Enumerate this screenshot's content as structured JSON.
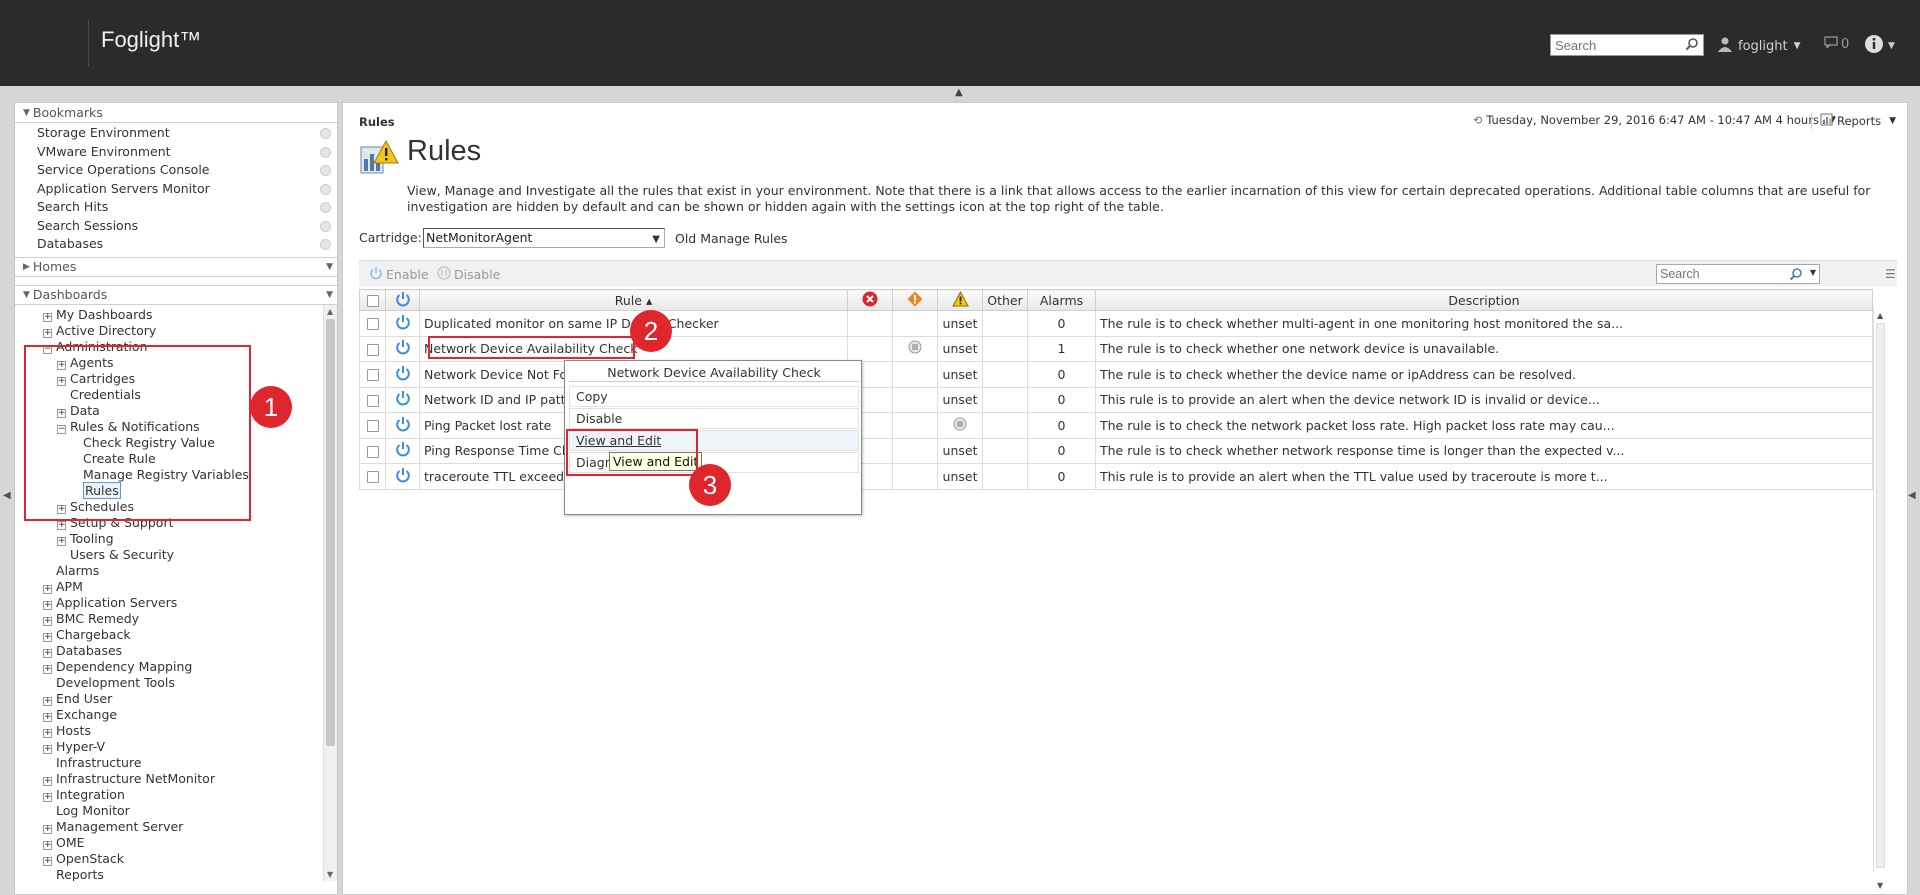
{
  "header": {
    "brand": "Foglight™",
    "search_placeholder": "Search",
    "user": "foglight",
    "messages_count": "0"
  },
  "bookmarks": {
    "title": "Bookmarks",
    "items": [
      "Storage Environment",
      "VMware Environment",
      "Service Operations Console",
      "Application Servers Monitor",
      "Search Hits",
      "Search Sessions",
      "Databases"
    ]
  },
  "homes": {
    "title": "Homes"
  },
  "dashboards": {
    "title": "Dashboards",
    "tree": [
      {
        "label": "My Dashboards",
        "pm": "+",
        "level": 0
      },
      {
        "label": "Active Directory",
        "pm": "+",
        "level": 0
      },
      {
        "label": "Administration",
        "pm": "−",
        "level": 0
      },
      {
        "label": "Agents",
        "pm": "+",
        "level": 1
      },
      {
        "label": "Cartridges",
        "pm": "+",
        "level": 1
      },
      {
        "label": "Credentials",
        "pm": "",
        "level": 1
      },
      {
        "label": "Data",
        "pm": "+",
        "level": 1
      },
      {
        "label": "Rules & Notifications",
        "pm": "−",
        "level": 1
      },
      {
        "label": "Check Registry Value",
        "pm": "",
        "level": 2
      },
      {
        "label": "Create Rule",
        "pm": "",
        "level": 2
      },
      {
        "label": "Manage Registry Variables",
        "pm": "",
        "level": 2
      },
      {
        "label": "Rules",
        "pm": "",
        "level": 2,
        "selected": true
      },
      {
        "label": "Schedules",
        "pm": "+",
        "level": 1
      },
      {
        "label": "Setup & Support",
        "pm": "+",
        "level": 1
      },
      {
        "label": "Tooling",
        "pm": "+",
        "level": 1
      },
      {
        "label": "Users & Security",
        "pm": "",
        "level": 1
      },
      {
        "label": "Alarms",
        "pm": "",
        "level": 0
      },
      {
        "label": "APM",
        "pm": "+",
        "level": 0
      },
      {
        "label": "Application Servers",
        "pm": "+",
        "level": 0
      },
      {
        "label": "BMC Remedy",
        "pm": "+",
        "level": 0
      },
      {
        "label": "Chargeback",
        "pm": "+",
        "level": 0
      },
      {
        "label": "Databases",
        "pm": "+",
        "level": 0
      },
      {
        "label": "Dependency Mapping",
        "pm": "+",
        "level": 0
      },
      {
        "label": "Development Tools",
        "pm": "",
        "level": 0
      },
      {
        "label": "End User",
        "pm": "+",
        "level": 0
      },
      {
        "label": "Exchange",
        "pm": "+",
        "level": 0
      },
      {
        "label": "Hosts",
        "pm": "+",
        "level": 0
      },
      {
        "label": "Hyper-V",
        "pm": "+",
        "level": 0
      },
      {
        "label": "Infrastructure",
        "pm": "",
        "level": 0
      },
      {
        "label": "Infrastructure NetMonitor",
        "pm": "+",
        "level": 0
      },
      {
        "label": "Integration",
        "pm": "+",
        "level": 0
      },
      {
        "label": "Log Monitor",
        "pm": "",
        "level": 0
      },
      {
        "label": "Management Server",
        "pm": "+",
        "level": 0
      },
      {
        "label": "OME",
        "pm": "+",
        "level": 0
      },
      {
        "label": "OpenStack",
        "pm": "+",
        "level": 0
      },
      {
        "label": "Reports",
        "pm": "",
        "level": 0
      }
    ]
  },
  "main": {
    "breadcrumb": "Rules",
    "time_range": "Tuesday, November 29, 2016 6:47 AM - 10:47 AM 4 hours",
    "reports_label": "Reports",
    "title": "Rules",
    "description": "View, Manage and Investigate all the rules that exist in your environment. Note that there is a link that allows access to the earlier incarnation of this view for certain deprecated operations. Additional table columns that are useful for investigation are hidden by default and can be shown or hidden again with the settings icon at the top right of the table.",
    "cartridge_label": "Cartridge:",
    "cartridge_value": "NetMonitorAgent",
    "old_manage_link": "Old Manage Rules",
    "toolbar": {
      "enable": "Enable",
      "disable": "Disable",
      "search_placeholder": "Search"
    },
    "columns": {
      "rule": "Rule ▴",
      "other": "Other",
      "alarms": "Alarms",
      "description": "Description"
    },
    "rows": [
      {
        "rule": "Duplicated monitor on same IP Device Checker",
        "warn": "unset",
        "alarms": "0",
        "desc": "The rule is to check whether multi-agent in one monitoring host monitored the sa...",
        "fatal_icon": false,
        "warn_icon": false
      },
      {
        "rule": "Network Device Availability Check",
        "warn": "unset",
        "alarms": "1",
        "desc": "The rule is to check whether one network device is unavailable.",
        "fatal_icon": true,
        "warn_icon": false
      },
      {
        "rule": "Network Device Not Found",
        "warn": "unset",
        "alarms": "0",
        "desc": "The rule is to check whether the device name or ipAddress can be resolved.",
        "fatal_icon": false,
        "warn_icon": false
      },
      {
        "rule": "Network ID and IP pattern check",
        "warn": "unset",
        "alarms": "0",
        "desc": "This rule is to provide an alert when the device network ID is invalid or device...",
        "fatal_icon": false,
        "warn_icon": false
      },
      {
        "rule": "Ping Packet lost rate",
        "warn": "",
        "alarms": "0",
        "desc": "The rule is to check the network packet loss rate. High packet loss rate may cau...",
        "fatal_icon": false,
        "warn_icon": true
      },
      {
        "rule": "Ping Response Time Check",
        "warn": "unset",
        "alarms": "0",
        "desc": "The rule is to check whether network response time is longer than the expected v...",
        "fatal_icon": false,
        "warn_icon": false
      },
      {
        "rule": "traceroute TTL exceeded",
        "warn": "unset",
        "alarms": "0",
        "desc": "This rule is to provide an alert when the TTL value used by traceroute is more t...",
        "fatal_icon": false,
        "warn_icon": false
      }
    ]
  },
  "context_menu": {
    "title": "Network Device Availability Check",
    "items": [
      "Copy",
      "Disable",
      "View and Edit",
      "Diagnose"
    ],
    "tooltip": "View and Edit"
  },
  "annotations": [
    "1",
    "2",
    "3"
  ],
  "colors": {
    "accent_red": "#e0262d",
    "header_bg": "#2b2b2b",
    "power_blue": "#3a8fd9"
  }
}
